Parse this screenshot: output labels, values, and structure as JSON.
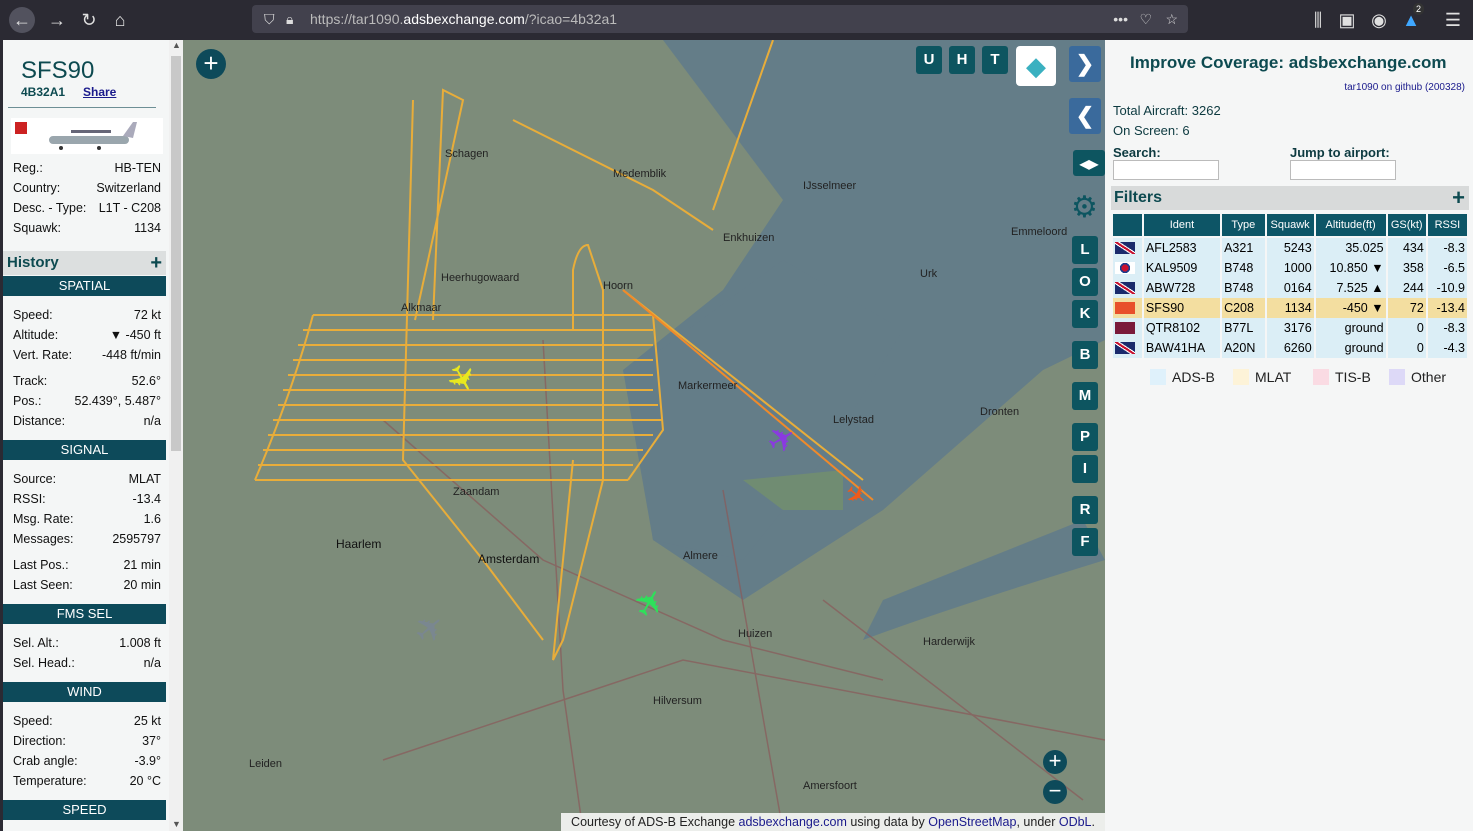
{
  "browser": {
    "url_prefix": "https://tar1090.",
    "url_domain": "adsbexchange.com",
    "url_suffix": "/?icao=4b32a1",
    "notif_count": "2"
  },
  "aircraft": {
    "callsign": "SFS90",
    "icao": "4B32A1",
    "share": "Share",
    "details": [
      {
        "k": "Reg.:",
        "v": "HB-TEN"
      },
      {
        "k": "Country:",
        "v": "Switzerland"
      },
      {
        "k": "Desc. - Type:",
        "v": "L1T - C208"
      },
      {
        "k": "Squawk:",
        "v": "1134"
      }
    ],
    "history": "History",
    "spatial_title": "SPATIAL",
    "spatial": [
      {
        "k": "Speed:",
        "v": "72 kt"
      },
      {
        "k": "Altitude:",
        "v": "▼ -450 ft"
      },
      {
        "k": "Vert. Rate:",
        "v": "-448 ft/min"
      },
      {
        "k": "Track:",
        "v": "52.6°"
      },
      {
        "k": "Pos.:",
        "v": "52.439°, 5.487°"
      },
      {
        "k": "Distance:",
        "v": "n/a"
      }
    ],
    "signal_title": "SIGNAL",
    "signal": [
      {
        "k": "Source:",
        "v": "MLAT"
      },
      {
        "k": "RSSI:",
        "v": "-13.4"
      },
      {
        "k": "Msg. Rate:",
        "v": "1.6"
      },
      {
        "k": "Messages:",
        "v": "2595797"
      },
      {
        "k": "Last Pos.:",
        "v": "21 min"
      },
      {
        "k": "Last Seen:",
        "v": "20 min"
      }
    ],
    "fms_title": "FMS SEL",
    "fms": [
      {
        "k": "Sel. Alt.:",
        "v": "1.008 ft"
      },
      {
        "k": "Sel. Head.:",
        "v": "n/a"
      }
    ],
    "wind_title": "WIND",
    "wind": [
      {
        "k": "Speed:",
        "v": "25 kt"
      },
      {
        "k": "Direction:",
        "v": "37°"
      },
      {
        "k": "Crab angle:",
        "v": "-3.9°"
      },
      {
        "k": "Temperature:",
        "v": "20 °C"
      }
    ],
    "speed_title": "SPEED"
  },
  "map": {
    "buttons_top": [
      "U",
      "H",
      "T"
    ],
    "side_buttons": [
      "L",
      "O",
      "K",
      "B",
      "M",
      "P",
      "I",
      "R",
      "F"
    ],
    "labels": [
      "Schagen",
      "Medemblik",
      "IJsselmeer",
      "Enkhuizen",
      "Alkmaar",
      "Heerhugowaard",
      "Hoorn",
      "Markermeer",
      "Lelystad",
      "Zaandam",
      "Haarlem",
      "Amsterdam",
      "Almere",
      "Huizen",
      "Hilversum",
      "Amersfoort",
      "Leiden",
      "Dronten",
      "Harderwijk",
      "Emmeloord",
      "Urk"
    ],
    "attribution": {
      "prefix": "Courtesy of ADS-B Exchange ",
      "link1": "adsbexchange.com",
      "mid": " using data by ",
      "link2": "OpenStreetMap",
      "mid2": ", under ",
      "link3": "ODbL",
      "end": "."
    }
  },
  "panel": {
    "improve": "Improve Coverage: ",
    "improve_link": "adsbexchange.com",
    "github": "tar1090 on github (200328)",
    "total": "Total Aircraft: 3262",
    "onscreen": "On Screen: 6",
    "search_label": "Search:",
    "search_value": "",
    "airport_label": "Jump to airport:",
    "airport_value": "",
    "filters": "Filters",
    "columns": [
      "",
      "Ident",
      "Type",
      "Squawk",
      "Altitude(ft)",
      "GS(kt)",
      "RSSI"
    ],
    "rows": [
      {
        "flag": "uk",
        "ident": "AFL2583",
        "type": "A321",
        "squawk": "5243",
        "alt": "35.025",
        "gs": "434",
        "rssi": "-8.3"
      },
      {
        "flag": "kr",
        "ident": "KAL9509",
        "type": "B748",
        "squawk": "1000",
        "alt": "10.850 ▼",
        "gs": "358",
        "rssi": "-6.5"
      },
      {
        "flag": "uk",
        "ident": "ABW728",
        "type": "B748",
        "squawk": "0164",
        "alt": "7.525 ▲",
        "gs": "244",
        "rssi": "-10.9"
      },
      {
        "flag": "ch",
        "ident": "SFS90",
        "type": "C208",
        "squawk": "1134",
        "alt": "-450 ▼",
        "gs": "72",
        "rssi": "-13.4"
      },
      {
        "flag": "qa",
        "ident": "QTR8102",
        "type": "B77L",
        "squawk": "3176",
        "alt": "ground",
        "gs": "0",
        "rssi": "-8.3"
      },
      {
        "flag": "uk",
        "ident": "BAW41HA",
        "type": "A20N",
        "squawk": "6260",
        "alt": "ground",
        "gs": "0",
        "rssi": "-4.3"
      }
    ],
    "legend": [
      {
        "label": "ADS-B",
        "color": "#dff1fb"
      },
      {
        "label": "MLAT",
        "color": "#fdf3d8"
      },
      {
        "label": "TIS-B",
        "color": "#fadbe3"
      },
      {
        "label": "Other",
        "color": "#ddd9f7"
      }
    ]
  }
}
